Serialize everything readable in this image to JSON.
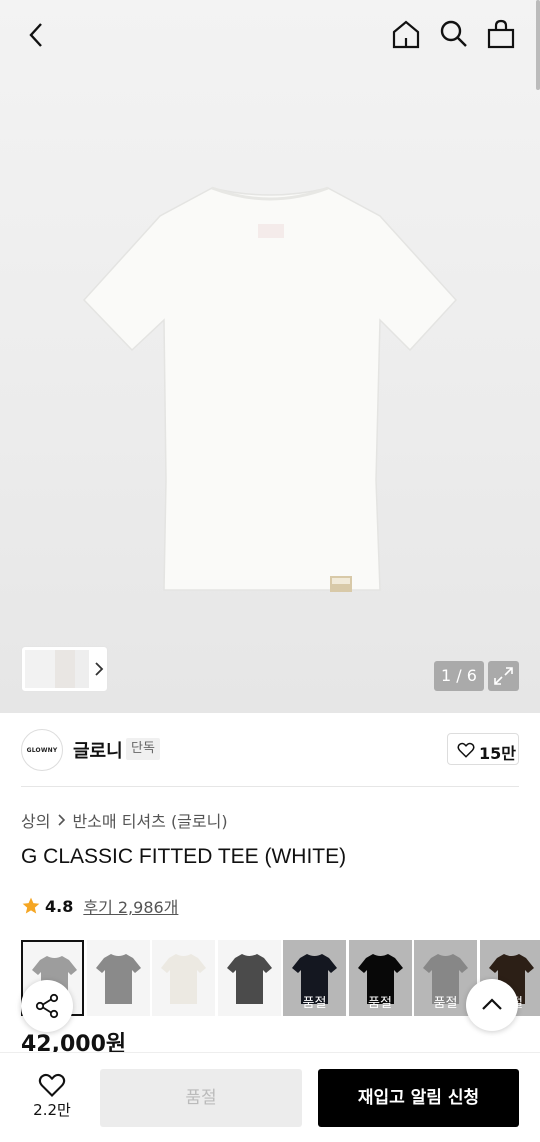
{
  "gallery": {
    "counter": "1 / 6"
  },
  "brand": {
    "logo_text": "GLOWNY",
    "name": "글로니",
    "tag": "단독",
    "likes": "15만"
  },
  "breadcrumb": {
    "level1": "상의",
    "level2": "반소매 티셔츠 (글로니)"
  },
  "product": {
    "title": "G CLASSIC FITTED TEE (WHITE)",
    "price": "42,000원"
  },
  "rating": {
    "score": "4.8",
    "reviews": "후기 2,986개",
    "star_color": "#f5a623"
  },
  "swatches": [
    {
      "color": "#9d9d9d",
      "selected": true,
      "soldout": ""
    },
    {
      "color": "#8a8a8a",
      "selected": false,
      "soldout": ""
    },
    {
      "color": "#ece9e2",
      "selected": false,
      "soldout": ""
    },
    {
      "color": "#4b4b4b",
      "selected": false,
      "soldout": ""
    },
    {
      "color": "#1b1f2b",
      "selected": false,
      "soldout": "품절"
    },
    {
      "color": "#0b0b0b",
      "selected": false,
      "soldout": "품절"
    },
    {
      "color": "#b5b5b5",
      "selected": false,
      "soldout": "품절"
    },
    {
      "color": "#3b2a1e",
      "selected": false,
      "soldout": "품절"
    }
  ],
  "bottom": {
    "wish_count": "2.2만",
    "soldout_label": "품절",
    "restock_label": "재입고 알림 신청"
  }
}
